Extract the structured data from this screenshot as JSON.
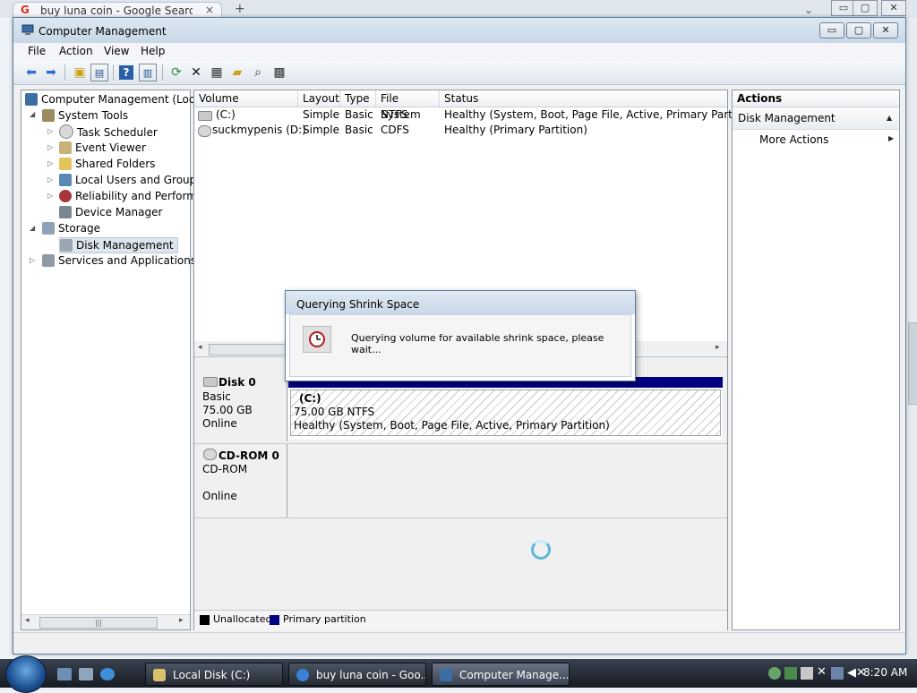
{
  "background_browser": {
    "tab_title": "buy luna coin - Google Search",
    "google_glyph": "G",
    "close_glyph": "×",
    "new_tab_glyph": "+",
    "overflow_glyph": "⌄"
  },
  "window": {
    "title": "Computer Management",
    "controls": {
      "minimize": "▭",
      "maximize": "▢",
      "close": "✕"
    }
  },
  "menu": [
    "File",
    "Action",
    "View",
    "Help"
  ],
  "toolbar_icons": [
    "back-arrow-icon",
    "forward-arrow-icon",
    "up-folder-icon",
    "show-hide-tree-icon",
    "help-icon",
    "properties-pane-icon",
    "refresh-icon",
    "delete-icon",
    "properties-icon",
    "open-icon",
    "search-icon",
    "export-icon"
  ],
  "tree": {
    "root": "Computer Management (Local",
    "system_tools": "System Tools",
    "task_scheduler": "Task Scheduler",
    "event_viewer": "Event Viewer",
    "shared_folders": "Shared Folders",
    "local_users": "Local Users and Groups",
    "reliability": "Reliability and Performa",
    "device_manager": "Device Manager",
    "storage": "Storage",
    "disk_management": "Disk Management",
    "services": "Services and Applications"
  },
  "volume_list": {
    "columns": [
      "Volume",
      "Layout",
      "Type",
      "File System",
      "Status"
    ],
    "rows": [
      {
        "volume": "(C:)",
        "layout": "Simple",
        "type": "Basic",
        "fs": "NTFS",
        "status": "Healthy (System, Boot, Page File, Active, Primary Partition)"
      },
      {
        "volume": "suckmypenis (D:)",
        "layout": "Simple",
        "type": "Basic",
        "fs": "CDFS",
        "status": "Healthy (Primary Partition)"
      }
    ]
  },
  "disks": [
    {
      "name": "Disk 0",
      "kind": "Basic",
      "size": "75.00 GB",
      "state": "Online",
      "partition": {
        "label": "(C:)",
        "size": "75.00 GB NTFS",
        "status": "Healthy (System, Boot, Page File, Active, Primary Partition)"
      }
    },
    {
      "name": "CD-ROM 0",
      "kind": "CD-ROM",
      "size": "",
      "state": "Online"
    }
  ],
  "legend": {
    "unallocated": "Unallocated",
    "primary": "Primary partition",
    "unallocated_color": "#000000",
    "primary_color": "#000080"
  },
  "actions": {
    "header": "Actions",
    "section": "Disk Management",
    "more": "More Actions",
    "collapse_glyph": "▲",
    "expand_glyph": "▶"
  },
  "dialog": {
    "title": "Querying Shrink Space",
    "message": "Querying volume for available shrink space, please wait..."
  },
  "taskbar": {
    "tasks": [
      "Local Disk (C:)",
      "buy luna coin - Goo...",
      "Computer Manage..."
    ],
    "clock": "8:20 AM"
  },
  "colors": {
    "partition_bar": "#000080",
    "accent": "#1f4f86"
  }
}
